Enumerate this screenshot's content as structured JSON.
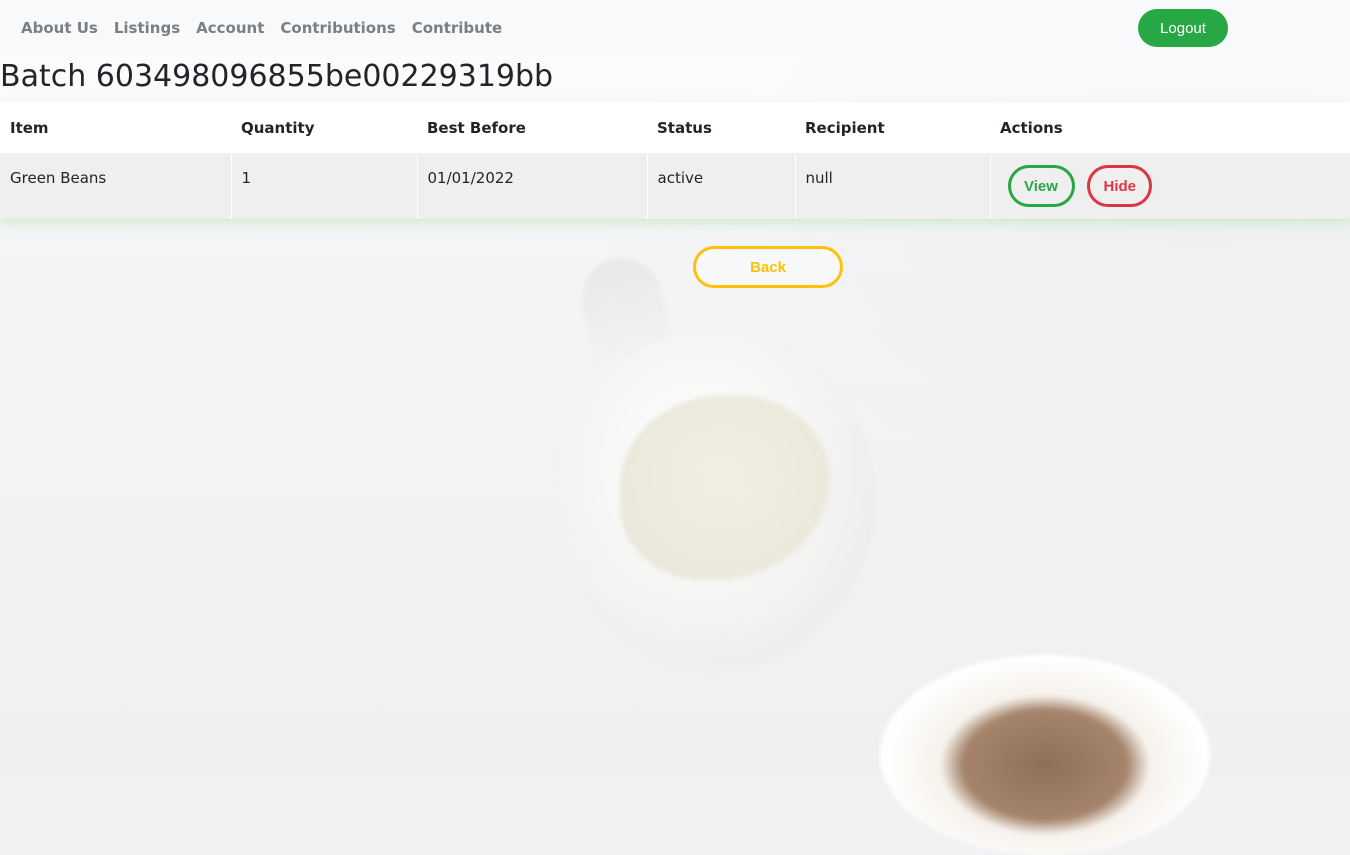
{
  "navbar": {
    "links": [
      "About Us",
      "Listings",
      "Account",
      "Contributions",
      "Contribute"
    ],
    "logout_label": "Logout"
  },
  "page": {
    "title": "Batch 603498096855be00229319bb"
  },
  "table": {
    "headers": [
      "Item",
      "Quantity",
      "Best Before",
      "Status",
      "Recipient",
      "Actions"
    ],
    "rows": [
      {
        "item": "Green Beans",
        "quantity": "1",
        "best_before": "01/01/2022",
        "status": "active",
        "recipient": "null",
        "view_label": "View",
        "hide_label": "Hide"
      }
    ]
  },
  "back_label": "Back",
  "colors": {
    "success": "#28a745",
    "danger": "#dc3545",
    "warning": "#ffc107",
    "navbar_bg": "#f8f9fa"
  }
}
